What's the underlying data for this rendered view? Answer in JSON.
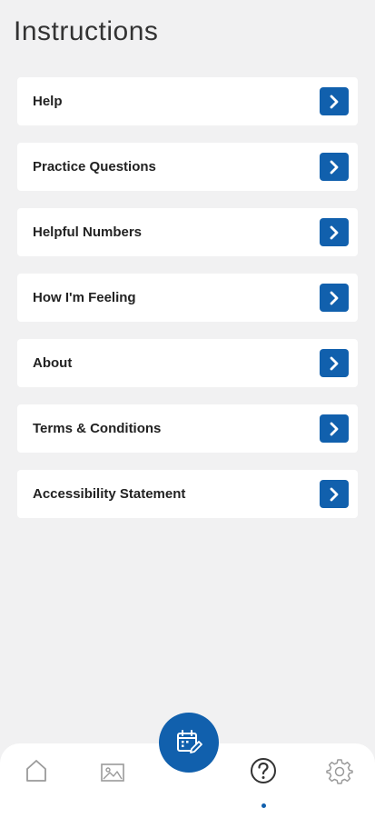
{
  "header": {
    "title": "Instructions"
  },
  "menu": {
    "items": [
      {
        "label": "Help",
        "icon": "chevron-right-icon"
      },
      {
        "label": "Practice Questions",
        "icon": "chevron-right-icon"
      },
      {
        "label": "Helpful Numbers",
        "icon": "chevron-right-icon"
      },
      {
        "label": "How I'm Feeling",
        "icon": "chevron-right-icon"
      },
      {
        "label": "About",
        "icon": "chevron-right-icon"
      },
      {
        "label": "Terms & Conditions",
        "icon": "chevron-right-icon"
      },
      {
        "label": "Accessibility Statement",
        "icon": "chevron-right-icon"
      }
    ]
  },
  "bottom_nav": {
    "items": [
      "home-icon",
      "gallery-icon",
      "calendar-edit-icon",
      "help-icon",
      "settings-icon"
    ],
    "active": "help-icon"
  },
  "colors": {
    "accent": "#1160ad",
    "background": "#f1f1f2",
    "card": "#ffffff",
    "text": "#222222",
    "nav_icon": "#9a9a9a"
  }
}
